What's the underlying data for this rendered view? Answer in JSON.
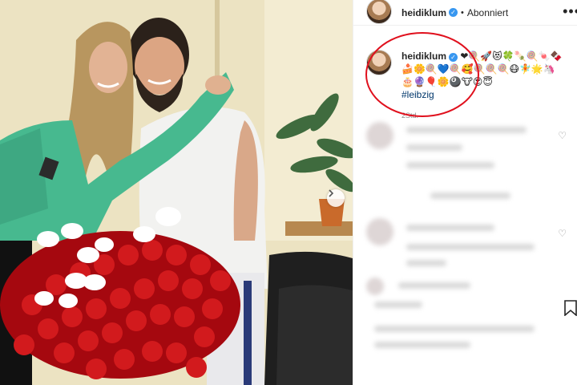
{
  "header": {
    "username": "heidiklum",
    "separator": "•",
    "follow_status": "Abonniert",
    "more_label": "•••"
  },
  "caption": {
    "username": "heidiklum",
    "emoji_text": "❤🍭🚀😻🍀🍡🍭🍬🍫🍰🌼🍭💙🍭🥰🍭🍭🍭😷🧚🌟🦄🎂🔮🎈🌼🎱🐮😍😇",
    "hashtag": "#leibzig",
    "time": "2Std."
  },
  "icons": {
    "verified": "verified-badge-icon",
    "like": "heart-icon",
    "save": "bookmark-icon",
    "next": "chevron-right-icon"
  },
  "colors": {
    "verified": "#3897f0",
    "hashtag": "#00376b",
    "highlight": "#e0101d",
    "jacket": "#47b98f",
    "roses": "#c8161b"
  }
}
